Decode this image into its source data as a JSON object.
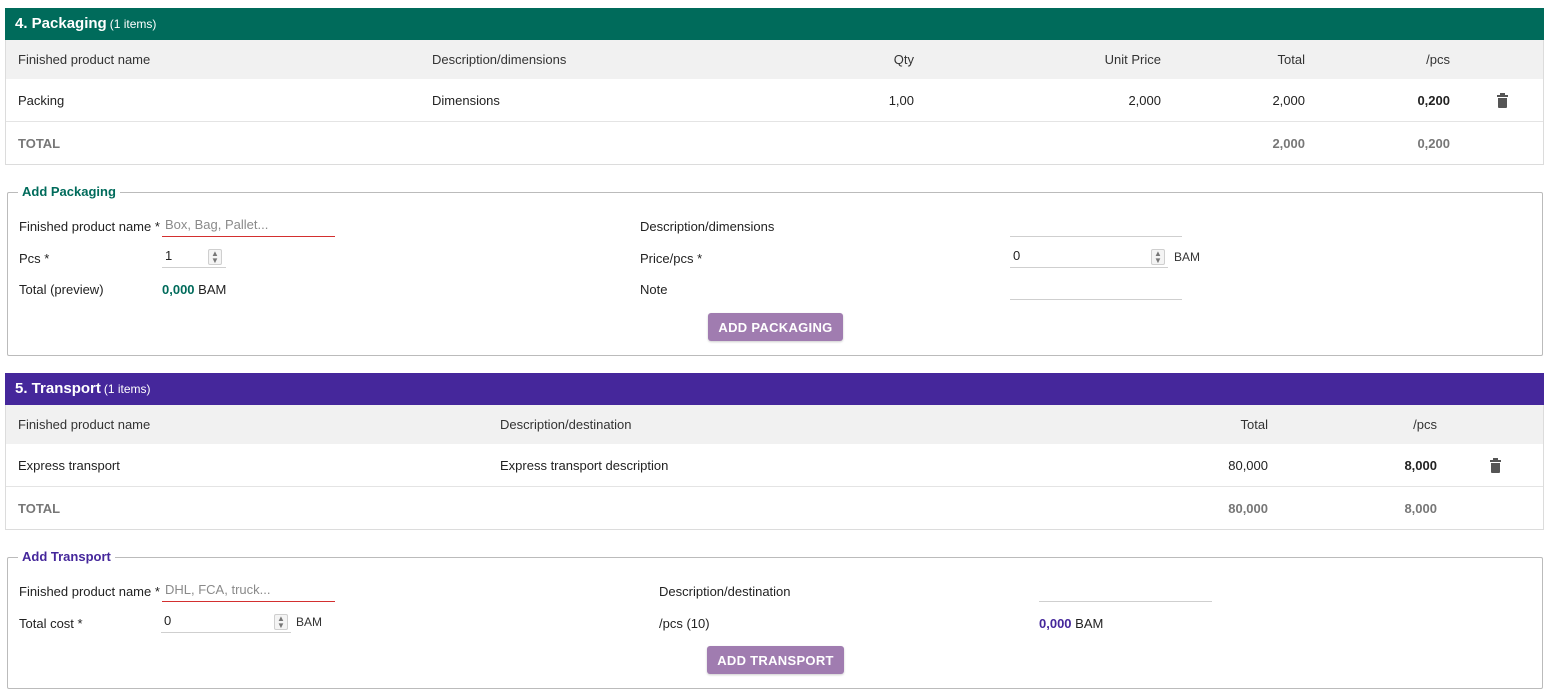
{
  "packaging": {
    "header": {
      "title": "4. Packaging",
      "count": "(1 items)"
    },
    "table": {
      "columns": {
        "name": "Finished product name",
        "desc": "Description/dimensions",
        "qty": "Qty",
        "unit_price": "Unit Price",
        "total": "Total",
        "pcs": "/pcs"
      },
      "rows": [
        {
          "name": "Packing",
          "desc": "Dimensions",
          "qty": "1,00",
          "unit_price": "2,000",
          "total": "2,000",
          "pcs": "0,200"
        }
      ],
      "total_row": {
        "label": "TOTAL",
        "total": "2,000",
        "pcs": "0,200"
      }
    },
    "form": {
      "legend": "Add Packaging",
      "name_label": "Finished product name *",
      "name_placeholder": "Box, Bag, Pallet...",
      "pcs_label": "Pcs *",
      "pcs_value": "1",
      "preview_label": "Total (preview)",
      "preview_value": "0,000",
      "preview_unit": "BAM",
      "desc_label": "Description/dimensions",
      "price_label": "Price/pcs *",
      "price_value": "0",
      "price_unit": "BAM",
      "note_label": "Note",
      "button": "ADD PACKAGING"
    }
  },
  "transport": {
    "header": {
      "title": "5. Transport",
      "count": "(1 items)"
    },
    "table": {
      "columns": {
        "name": "Finished product name",
        "desc": "Description/destination",
        "total": "Total",
        "pcs": "/pcs"
      },
      "rows": [
        {
          "name": "Express transport",
          "desc": "Express transport description",
          "total": "80,000",
          "pcs": "8,000"
        }
      ],
      "total_row": {
        "label": "TOTAL",
        "total": "80,000",
        "pcs": "8,000"
      }
    },
    "form": {
      "legend": "Add Transport",
      "name_label": "Finished product name *",
      "name_placeholder": "DHL, FCA, truck...",
      "cost_label": "Total cost *",
      "cost_value": "0",
      "cost_unit": "BAM",
      "desc_label": "Description/destination",
      "pcs_label": "/pcs (10)",
      "pcs_value": "0,000",
      "pcs_unit": "BAM",
      "button": "ADD TRANSPORT"
    }
  },
  "colors": {
    "packaging": "#006b5b",
    "transport": "#45279b",
    "button": "#a07cb0"
  }
}
